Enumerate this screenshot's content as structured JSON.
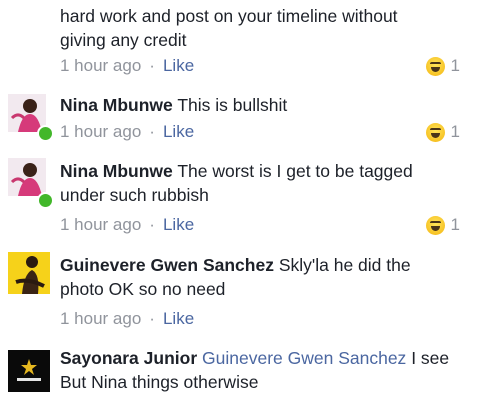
{
  "comments": [
    {
      "text_lines": [
        "hard work and post on your timeline without",
        "giving any credit"
      ],
      "time": "1 hour ago",
      "like": "Like",
      "reaction_count": "1"
    },
    {
      "author": "Nina Mbunwe",
      "text": "This is bullshit",
      "time": "1 hour ago",
      "like": "Like",
      "reaction_count": "1"
    },
    {
      "author": "Nina Mbunwe",
      "text_line1": "The worst is I get to be tagged",
      "text_line2": "under such rubbish",
      "time": "1 hour ago",
      "like": "Like",
      "reaction_count": "1"
    },
    {
      "author": "Guinevere Gwen Sanchez",
      "text_line1": "Skly'la he did the",
      "text_line2": "photo OK so no need",
      "time": "1 hour ago",
      "like": "Like"
    },
    {
      "author": "Sayonara Junior",
      "mention": "Guinevere Gwen Sanchez",
      "text_line1": "I see",
      "text_line2": "But Nina things otherwise"
    }
  ],
  "separator": "·",
  "reaction_icon": "haha-emoji-icon",
  "colors": {
    "link": "#4b67a1",
    "meta": "#90949c",
    "online": "#42b72a"
  }
}
